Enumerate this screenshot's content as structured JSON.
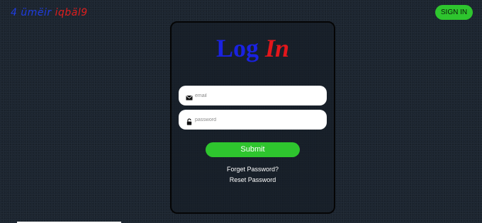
{
  "header": {
    "logo": {
      "part_a": "4 ümëir",
      "part_b": "iqbäl9"
    },
    "signin_label": "SIGN IN"
  },
  "login_card": {
    "title": {
      "part_a": "Log",
      "part_b": "In"
    },
    "email": {
      "placeholder": "email",
      "value": "",
      "icon": "envelope-icon"
    },
    "password": {
      "placeholder": "password",
      "value": "",
      "icon": "lock-icon"
    },
    "submit_label": "Submit",
    "forget_password_label": "Forget Password?",
    "reset_password_label": "Reset Password"
  },
  "colors": {
    "background": "#1c2530",
    "accent_green": "#2ec52e",
    "title_blue": "#1a22e0",
    "title_red": "#e3161b"
  }
}
